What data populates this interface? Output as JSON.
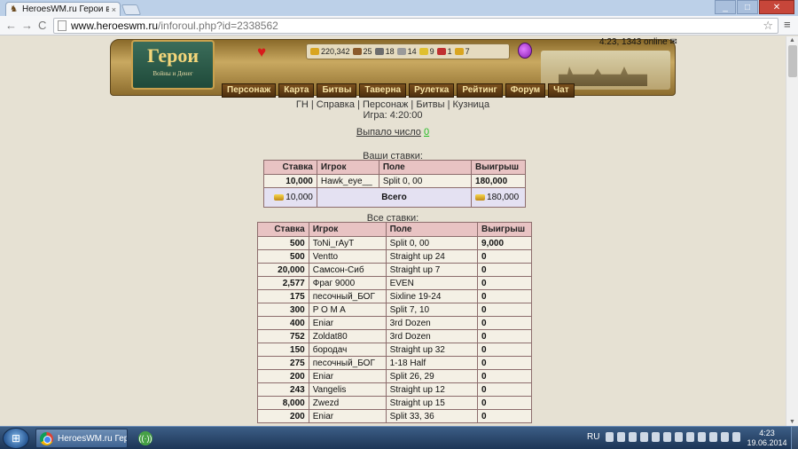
{
  "browser": {
    "tab_title": "HeroesWM.ru Герои войн",
    "tab_close": "×",
    "url_domain": "www.heroeswm.ru",
    "url_path": "/inforoul.php?id=2338562",
    "back": "←",
    "forward": "→",
    "reload": "C",
    "star": "☆",
    "menu": "≡",
    "win_min": "_",
    "win_max": "□",
    "win_close": "✕"
  },
  "game": {
    "logo_title": "Герои",
    "logo_sub": "Войны и Денег",
    "resources": [
      {
        "name": "gold",
        "value": "220,342",
        "color": "#d9a520"
      },
      {
        "name": "wood",
        "value": "25",
        "color": "#8b5a2b"
      },
      {
        "name": "ore",
        "value": "18",
        "color": "#6d6d6d"
      },
      {
        "name": "mercury",
        "value": "14",
        "color": "#9a9a9a"
      },
      {
        "name": "sulfur",
        "value": "9",
        "color": "#e0c030"
      },
      {
        "name": "crystals",
        "value": "1",
        "color": "#c03030"
      },
      {
        "name": "gems",
        "value": "7",
        "color": "#d9a520"
      }
    ],
    "online": "4:23, 1343 online",
    "menu": [
      "Персонаж",
      "Карта",
      "Битвы",
      "Таверна",
      "Рулетка",
      "Рейтинг",
      "Форум",
      "Чат"
    ],
    "sublinks": [
      "ГН",
      "Справка",
      "Персонаж",
      "Битвы",
      "Кузница"
    ],
    "game_label": "Игра: 4:20:00",
    "result_label": "Выпало число",
    "result_value": "0",
    "result_color": "#22bb22"
  },
  "your_bets": {
    "caption": "Ваши ставки:",
    "headers": [
      "Ставка",
      "Игрок",
      "Поле",
      "Выигрыш"
    ],
    "rows": [
      {
        "stake": "10,000",
        "player": "Hawk_eye__",
        "field": "Split 0, 00",
        "win": "180,000"
      }
    ],
    "total_stake": "10,000",
    "total_label": "Всего",
    "total_win": "180,000"
  },
  "all_bets": {
    "caption": "Все ставки:",
    "headers": [
      "Ставка",
      "Игрок",
      "Поле",
      "Выигрыш"
    ],
    "rows": [
      {
        "stake": "500",
        "player": "ToNi_rAyT",
        "field": "Split 0, 00",
        "win": "9,000"
      },
      {
        "stake": "500",
        "player": "Ventto",
        "field": "Straight up 24",
        "win": "0"
      },
      {
        "stake": "20,000",
        "player": "Самсон-Сиб",
        "field": "Straight up 7",
        "win": "0"
      },
      {
        "stake": "2,577",
        "player": "Фраг 9000",
        "field": "EVEN",
        "win": "0"
      },
      {
        "stake": "175",
        "player": "песочный_БОГ",
        "field": "Sixline 19-24",
        "win": "0"
      },
      {
        "stake": "300",
        "player": "P O M A",
        "field": "Split 7, 10",
        "win": "0"
      },
      {
        "stake": "400",
        "player": "Eniar",
        "field": "3rd Dozen",
        "win": "0"
      },
      {
        "stake": "752",
        "player": "Zoldat80",
        "field": "3rd Dozen",
        "win": "0"
      },
      {
        "stake": "150",
        "player": "бородач",
        "field": "Straight up 32",
        "win": "0"
      },
      {
        "stake": "275",
        "player": "песочный_БОГ",
        "field": "1-18 Half",
        "win": "0"
      },
      {
        "stake": "200",
        "player": "Eniar",
        "field": "Split 26, 29",
        "win": "0"
      },
      {
        "stake": "243",
        "player": "Vangelis",
        "field": "Straight up 12",
        "win": "0"
      },
      {
        "stake": "8,000",
        "player": "Zwezd",
        "field": "Straight up 15",
        "win": "0"
      },
      {
        "stake": "200",
        "player": "Eniar",
        "field": "Split 33, 36",
        "win": "0"
      }
    ]
  },
  "taskbar": {
    "start": "⊞",
    "task_label": "HeroesWM.ru Гер...",
    "lang": "RU",
    "time": "4:23",
    "date": "19.06.2014"
  }
}
